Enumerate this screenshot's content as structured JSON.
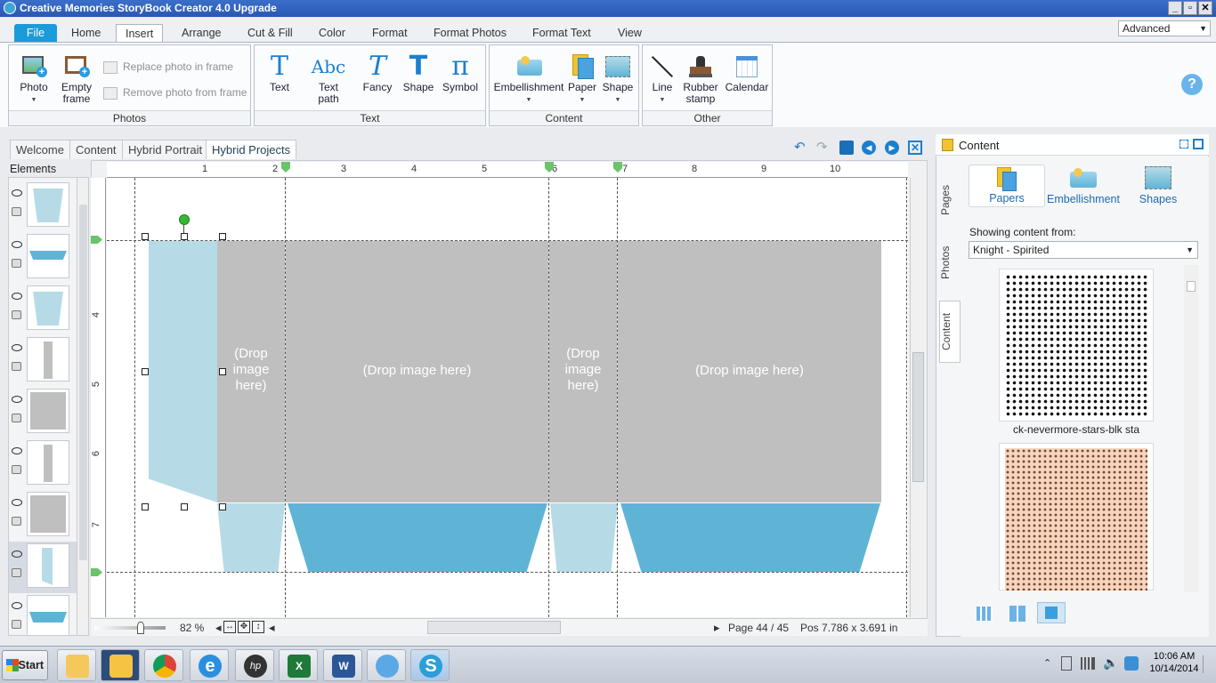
{
  "window": {
    "title": "Creative Memories StoryBook Creator 4.0 Upgrade",
    "buttons": [
      "_",
      "▫",
      "✕"
    ]
  },
  "ribbon_tabs": [
    "File",
    "Home",
    "Insert",
    "Arrange",
    "Cut & Fill",
    "Color",
    "Format",
    "Format Photos",
    "Format Text",
    "View"
  ],
  "active_tab": "Insert",
  "mode_select": "Advanced",
  "groups": {
    "photos": {
      "label": "Photos",
      "photo": "Photo",
      "empty_frame_1": "Empty",
      "empty_frame_2": "frame",
      "replace": "Replace photo in frame",
      "remove": "Remove photo from frame"
    },
    "text": {
      "label": "Text",
      "text": "Text",
      "text_path_1": "Text",
      "text_path_2": "path",
      "fancy": "Fancy",
      "shape": "Shape",
      "symbol": "Symbol"
    },
    "content": {
      "label": "Content",
      "embellishment": "Embellishment",
      "paper": "Paper",
      "shape": "Shape"
    },
    "other": {
      "label": "Other",
      "line": "Line",
      "rubber_1": "Rubber",
      "rubber_2": "stamp",
      "calendar": "Calendar"
    }
  },
  "help": "?",
  "doc_tabs": [
    "Welcome",
    "Content",
    "Hybrid Portrait",
    "Hybrid Projects"
  ],
  "elements_title": "Elements",
  "ruler_h": [
    "1",
    "2",
    "3",
    "4",
    "5",
    "6",
    "7",
    "8",
    "9",
    "10"
  ],
  "ruler_v": [
    "4",
    "5",
    "6",
    "7"
  ],
  "drop": {
    "narrow": "(Drop image here)",
    "wide": "(Drop image here)"
  },
  "status": {
    "zoom": "82 %",
    "page": "Page 44 / 45",
    "pos": "Pos 7.786 x 3.691 in"
  },
  "right_panel": {
    "title": "Content",
    "vtabs": [
      "Pages",
      "Photos",
      "Content"
    ],
    "tabs": [
      "Papers",
      "Embellishment",
      "Shapes"
    ],
    "showing_label": "Showing content from:",
    "source": "Knight - Spirited",
    "items": [
      "ck-nevermore-stars-blk sta"
    ]
  },
  "taskbar": {
    "start": "Start",
    "time": "10:06 AM",
    "date": "10/14/2014"
  },
  "colors": {
    "accent": "#1b9bd9",
    "drop_gray": "#bfbfbf",
    "light_blue": "#b6dbe7",
    "mid_blue": "#5fb4d6"
  }
}
